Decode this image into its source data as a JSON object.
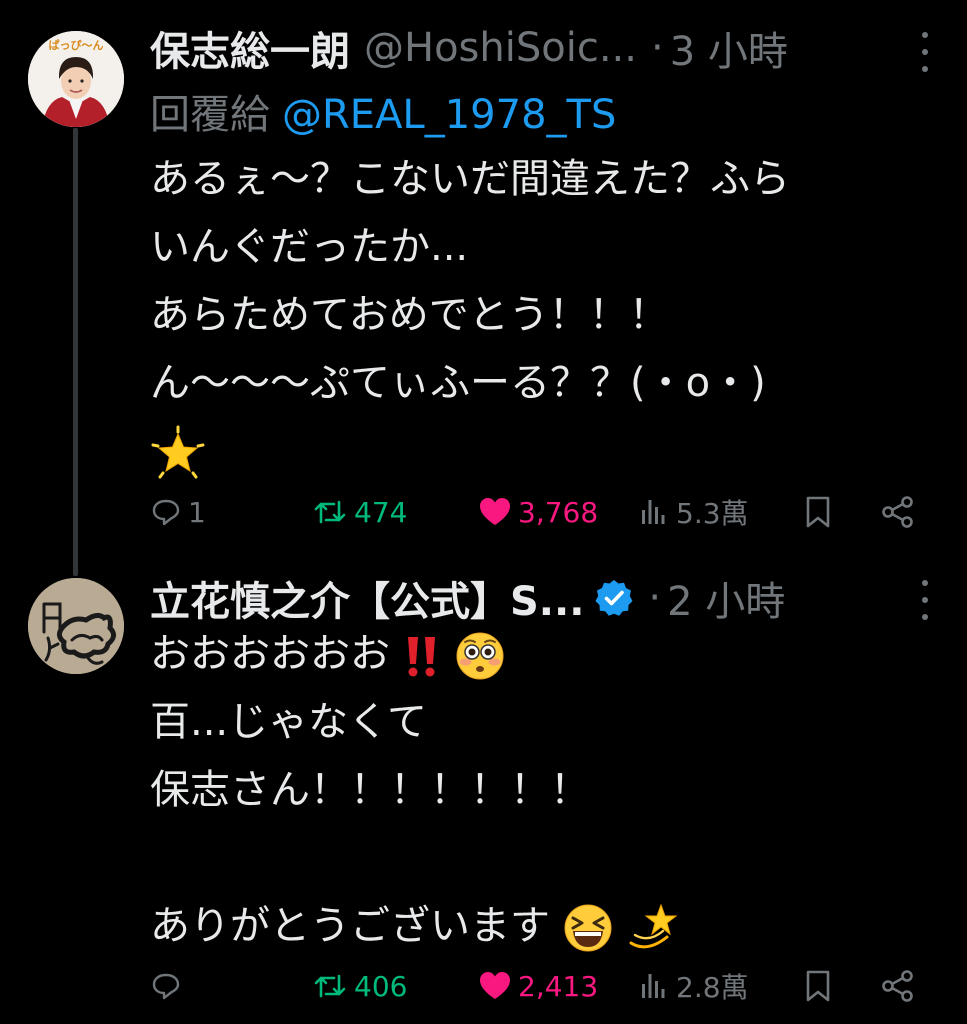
{
  "tweets": [
    {
      "display_name": "保志総一朗",
      "handle": "@HoshiSoic...",
      "separator": "·",
      "time": "3 小時",
      "reply_label": "回覆給",
      "reply_to": "@REAL_1978_TS",
      "avatar_label": "ぱっぴ〜ん",
      "lines": [
        "あるぇ〜？こないだ間違えた？ふら",
        "いんぐだったか...",
        "あらためておめでとう！！！",
        "ん〜〜〜ぷてぃふーる？？(・o・)"
      ],
      "trailing_emoji": "star-icon",
      "stats": {
        "replies": "1",
        "retweets": "474",
        "likes": "3,768",
        "views": "5.3萬"
      }
    },
    {
      "display_name": "立花慎之介【公式】S...",
      "verified": true,
      "separator": "·",
      "time": "2 小時",
      "lines": [
        "おおおおおお",
        "百...じゃなくて",
        "保志さん！！！！！！！",
        "",
        "ありがとうございます"
      ],
      "line1_emojis": [
        "double-exclamation-icon",
        "flushed-face-icon"
      ],
      "line5_emojis": [
        "grinning-squinting-face-icon",
        "dizzy-star-icon"
      ],
      "stats": {
        "replies": "",
        "retweets": "406",
        "likes": "2,413",
        "views": "2.8萬"
      }
    }
  ],
  "colors": {
    "background": "#000000",
    "text": "#e7e9ea",
    "muted": "#71767b",
    "link": "#1d9bf0",
    "retweet": "#00ba7c",
    "like": "#f91880",
    "verified": "#1d9bf0"
  }
}
